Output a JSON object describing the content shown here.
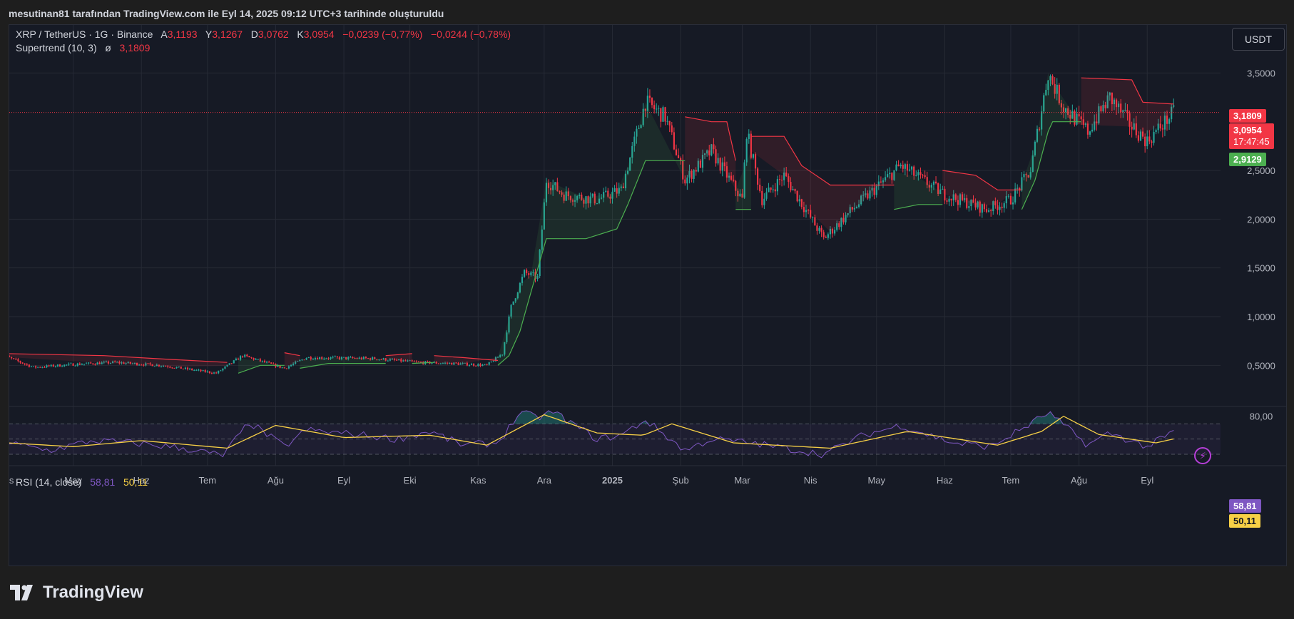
{
  "header": {
    "caption": "mesutinan81 tarafından TradingView.com ile Eyl 14, 2025 09:12 UTC+3 tarihinde oluşturuldu"
  },
  "legend": {
    "symbol": "XRP / TetherUS · 1G · Binance",
    "open_label": "A",
    "open": "3,1193",
    "high_label": "Y",
    "high": "3,1267",
    "low_label": "D",
    "low": "3,0762",
    "close_label": "K",
    "close": "3,0954",
    "change": "−0,0239 (−0,77%)",
    "change2": "−0,0244 (−0,78%)",
    "indicator_name": "Supertrend (10, 3)",
    "indicator_symbol": "ø",
    "indicator_value": "3,1809",
    "rsi_name": "RSI (14, close)",
    "rsi_value": "58,81",
    "rsi_ma_value": "50,11"
  },
  "toolbar": {
    "currency_label": "USDT"
  },
  "price_tags": {
    "supertrend_upper": "3,1809",
    "last_price": "3,0954",
    "countdown": "17:47:45",
    "supertrend_lower": "2,9129",
    "rsi": "58,81",
    "rsi_ma": "50,11"
  },
  "colors": {
    "up": "#26a69a",
    "down": "#f23645",
    "st_up": "#4caf50",
    "st_down": "#f23645",
    "rsi": "#7e57c2",
    "rsi_ma": "#f7d046",
    "grid": "#262a35"
  },
  "brand": {
    "name": "TradingView"
  },
  "chart_data": [
    {
      "type": "candlestick",
      "title": "XRP / TetherUS · 1G · Binance",
      "ylim": [
        0.1,
        3.7
      ],
      "y_ticks": [
        "0,5000",
        "1,0000",
        "1,5000",
        "2,0000",
        "2,5000",
        "3,5000"
      ],
      "y_tick_values": [
        0.5,
        1.0,
        1.5,
        2.0,
        2.5,
        3.5
      ],
      "x_ticks": [
        "Nis",
        "May",
        "Haz",
        "Tem",
        "Ağu",
        "Eyl",
        "Eki",
        "Kas",
        "Ara",
        "2025",
        "Şub",
        "Mar",
        "Nis",
        "May",
        "Haz",
        "Tem",
        "Ağu",
        "Eyl"
      ],
      "x_tick_dates": [
        "2024-04-01",
        "2024-05-01",
        "2024-06-01",
        "2024-07-01",
        "2024-08-01",
        "2024-09-01",
        "2024-10-01",
        "2024-11-01",
        "2024-12-01",
        "2025-01-01",
        "2025-02-01",
        "2025-03-01",
        "2025-04-01",
        "2025-05-01",
        "2025-06-01",
        "2025-07-01",
        "2025-08-01",
        "2025-09-01"
      ],
      "x_range": [
        "2024-04-01",
        "2025-10-15"
      ],
      "close_path": [
        [
          "2024-03-28",
          0.62
        ],
        [
          "2024-04-13",
          0.48
        ],
        [
          "2024-05-01",
          0.51
        ],
        [
          "2024-05-20",
          0.53
        ],
        [
          "2024-06-10",
          0.5
        ],
        [
          "2024-07-05",
          0.42
        ],
        [
          "2024-07-17",
          0.6
        ],
        [
          "2024-08-05",
          0.47
        ],
        [
          "2024-08-15",
          0.58
        ],
        [
          "2024-09-15",
          0.57
        ],
        [
          "2024-10-05",
          0.53
        ],
        [
          "2024-10-20",
          0.52
        ],
        [
          "2024-11-05",
          0.5
        ],
        [
          "2024-11-12",
          0.62
        ],
        [
          "2024-11-16",
          1.1
        ],
        [
          "2024-11-22",
          1.45
        ],
        [
          "2024-11-28",
          1.4
        ],
        [
          "2024-12-02",
          2.4
        ],
        [
          "2024-12-10",
          2.25
        ],
        [
          "2024-12-25",
          2.2
        ],
        [
          "2025-01-05",
          2.3
        ],
        [
          "2025-01-16",
          3.2
        ],
        [
          "2025-01-25",
          3.05
        ],
        [
          "2025-02-03",
          2.4
        ],
        [
          "2025-02-15",
          2.7
        ],
        [
          "2025-03-01",
          2.2
        ],
        [
          "2025-03-03",
          2.9
        ],
        [
          "2025-03-10",
          2.2
        ],
        [
          "2025-03-20",
          2.45
        ],
        [
          "2025-04-07",
          1.8
        ],
        [
          "2025-04-20",
          2.1
        ],
        [
          "2025-05-12",
          2.55
        ],
        [
          "2025-06-01",
          2.25
        ],
        [
          "2025-06-20",
          2.1
        ],
        [
          "2025-07-01",
          2.2
        ],
        [
          "2025-07-10",
          2.5
        ],
        [
          "2025-07-18",
          3.5
        ],
        [
          "2025-07-25",
          3.15
        ],
        [
          "2025-08-05",
          2.9
        ],
        [
          "2025-08-15",
          3.25
        ],
        [
          "2025-08-25",
          2.95
        ],
        [
          "2025-09-01",
          2.8
        ],
        [
          "2025-09-13",
          3.0954
        ]
      ],
      "series": [
        {
          "name": "Supertrend (10, 3)",
          "segments": [
            {
              "trend": "down",
              "points": [
                [
                  "2024-04-01",
                  0.62
                ],
                [
                  "2024-05-15",
                  0.6
                ],
                [
                  "2024-06-15",
                  0.56
                ],
                [
                  "2024-07-10",
                  0.53
                ]
              ]
            },
            {
              "trend": "up",
              "points": [
                [
                  "2024-07-15",
                  0.42
                ],
                [
                  "2024-07-25",
                  0.5
                ],
                [
                  "2024-08-05",
                  0.5
                ]
              ]
            },
            {
              "trend": "down",
              "points": [
                [
                  "2024-08-05",
                  0.63
                ],
                [
                  "2024-08-12",
                  0.6
                ]
              ]
            },
            {
              "trend": "up",
              "points": [
                [
                  "2024-08-12",
                  0.47
                ],
                [
                  "2024-08-25",
                  0.52
                ],
                [
                  "2024-09-10",
                  0.52
                ],
                [
                  "2024-09-20",
                  0.52
                ]
              ]
            },
            {
              "trend": "down",
              "points": [
                [
                  "2024-09-20",
                  0.6
                ],
                [
                  "2024-10-02",
                  0.62
                ]
              ]
            },
            {
              "trend": "up",
              "points": [
                [
                  "2024-10-02",
                  0.52
                ],
                [
                  "2024-10-12",
                  0.53
                ]
              ]
            },
            {
              "trend": "down",
              "points": [
                [
                  "2024-10-12",
                  0.6
                ],
                [
                  "2024-10-25",
                  0.58
                ],
                [
                  "2024-11-10",
                  0.55
                ]
              ]
            },
            {
              "trend": "up",
              "points": [
                [
                  "2024-11-10",
                  0.5
                ],
                [
                  "2024-11-15",
                  0.6
                ],
                [
                  "2024-11-20",
                  0.85
                ],
                [
                  "2024-11-25",
                  1.25
                ],
                [
                  "2024-12-02",
                  1.8
                ],
                [
                  "2024-12-20",
                  1.8
                ],
                [
                  "2025-01-03",
                  1.9
                ],
                [
                  "2025-01-08",
                  2.15
                ],
                [
                  "2025-01-16",
                  2.6
                ],
                [
                  "2025-02-03",
                  2.6
                ]
              ]
            },
            {
              "trend": "down",
              "points": [
                [
                  "2025-02-03",
                  3.05
                ],
                [
                  "2025-02-15",
                  3.0
                ],
                [
                  "2025-02-22",
                  3.0
                ],
                [
                  "2025-02-26",
                  2.6
                ]
              ]
            },
            {
              "trend": "up",
              "points": [
                [
                  "2025-02-26",
                  2.1
                ],
                [
                  "2025-03-05",
                  2.1
                ]
              ]
            },
            {
              "trend": "down",
              "points": [
                [
                  "2025-03-05",
                  2.85
                ],
                [
                  "2025-03-20",
                  2.85
                ],
                [
                  "2025-03-28",
                  2.55
                ],
                [
                  "2025-04-10",
                  2.35
                ],
                [
                  "2025-05-09",
                  2.35
                ]
              ]
            },
            {
              "trend": "up",
              "points": [
                [
                  "2025-05-09",
                  2.1
                ],
                [
                  "2025-05-20",
                  2.15
                ],
                [
                  "2025-05-31",
                  2.15
                ]
              ]
            },
            {
              "trend": "down",
              "points": [
                [
                  "2025-05-31",
                  2.5
                ],
                [
                  "2025-06-15",
                  2.45
                ],
                [
                  "2025-06-25",
                  2.3
                ],
                [
                  "2025-07-06",
                  2.3
                ]
              ]
            },
            {
              "trend": "up",
              "points": [
                [
                  "2025-07-06",
                  2.1
                ],
                [
                  "2025-07-12",
                  2.4
                ],
                [
                  "2025-07-18",
                  2.9
                ],
                [
                  "2025-07-20",
                  3.0
                ],
                [
                  "2025-08-02",
                  3.0
                ]
              ]
            },
            {
              "trend": "down",
              "points": [
                [
                  "2025-08-02",
                  3.45
                ],
                [
                  "2025-08-25",
                  3.43
                ],
                [
                  "2025-08-30",
                  3.2
                ],
                [
                  "2025-09-13",
                  3.1809
                ]
              ]
            }
          ]
        }
      ],
      "last_price": 3.0954,
      "supertrend_upper": 3.1809,
      "supertrend_lower": 2.9129
    },
    {
      "type": "line",
      "title": "RSI (14, close)",
      "ylim": [
        15,
        90
      ],
      "y_ticks": [
        "80,00"
      ],
      "y_tick_values": [
        80
      ],
      "bands": [
        70,
        50,
        30
      ],
      "series": [
        {
          "name": "RSI (14, close)",
          "points": [
            [
              "2024-04-01",
              45
            ],
            [
              "2024-04-20",
              35
            ],
            [
              "2024-05-10",
              48
            ],
            [
              "2024-06-01",
              44
            ],
            [
              "2024-06-20",
              38
            ],
            [
              "2024-07-08",
              28
            ],
            [
              "2024-07-20",
              72
            ],
            [
              "2024-08-05",
              40
            ],
            [
              "2024-08-15",
              62
            ],
            [
              "2024-09-10",
              55
            ],
            [
              "2024-09-25",
              50
            ],
            [
              "2024-10-10",
              60
            ],
            [
              "2024-10-25",
              42
            ],
            [
              "2024-11-10",
              45
            ],
            [
              "2024-11-20",
              85
            ],
            [
              "2024-11-28",
              78
            ],
            [
              "2024-12-05",
              86
            ],
            [
              "2024-12-25",
              50
            ],
            [
              "2025-01-05",
              55
            ],
            [
              "2025-01-16",
              75
            ],
            [
              "2025-02-03",
              35
            ],
            [
              "2025-02-15",
              50
            ],
            [
              "2025-03-05",
              45
            ],
            [
              "2025-04-07",
              30
            ],
            [
              "2025-04-25",
              55
            ],
            [
              "2025-05-12",
              68
            ],
            [
              "2025-06-05",
              45
            ],
            [
              "2025-06-22",
              40
            ],
            [
              "2025-07-10",
              70
            ],
            [
              "2025-07-18",
              85
            ],
            [
              "2025-08-05",
              42
            ],
            [
              "2025-08-15",
              58
            ],
            [
              "2025-09-01",
              40
            ],
            [
              "2025-09-13",
              58.81
            ]
          ]
        },
        {
          "name": "RSI-based MA",
          "points": [
            [
              "2024-04-01",
              45
            ],
            [
              "2024-05-01",
              40
            ],
            [
              "2024-06-01",
              48
            ],
            [
              "2024-07-10",
              38
            ],
            [
              "2024-08-01",
              68
            ],
            [
              "2024-09-01",
              52
            ],
            [
              "2024-10-10",
              55
            ],
            [
              "2024-11-05",
              42
            ],
            [
              "2024-12-01",
              82
            ],
            [
              "2024-12-25",
              58
            ],
            [
              "2025-01-15",
              55
            ],
            [
              "2025-01-28",
              70
            ],
            [
              "2025-02-25",
              45
            ],
            [
              "2025-04-10",
              38
            ],
            [
              "2025-05-15",
              60
            ],
            [
              "2025-06-25",
              42
            ],
            [
              "2025-07-15",
              60
            ],
            [
              "2025-07-25",
              80
            ],
            [
              "2025-08-10",
              56
            ],
            [
              "2025-09-05",
              45
            ],
            [
              "2025-09-13",
              50.11
            ]
          ]
        }
      ],
      "rsi_value": 58.81,
      "ma_value": 50.11
    }
  ]
}
